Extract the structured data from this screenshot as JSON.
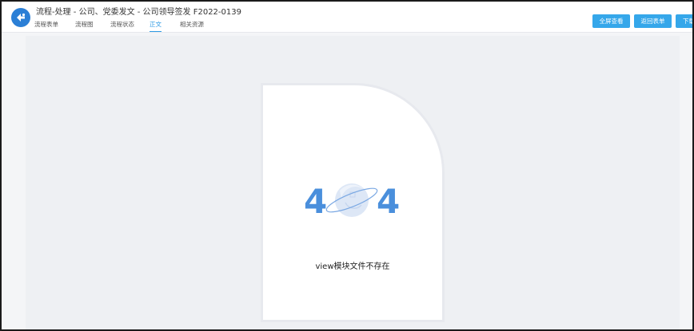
{
  "header": {
    "title": "流程-处理 - 公司、党委发文 - 公司领导签发 F2022-0139",
    "tabs": [
      {
        "label": "流程表单",
        "active": false
      },
      {
        "label": "流程图",
        "active": false
      },
      {
        "label": "流程状态",
        "active": false
      },
      {
        "label": "正文",
        "active": true
      },
      {
        "label": "相关资源",
        "active": false
      }
    ],
    "buttons": {
      "fullscreen": "全屏查看",
      "back_form": "返回表单",
      "download": "下载"
    }
  },
  "error": {
    "code_left": "4",
    "code_right": "4",
    "message": "view模块文件不存在"
  },
  "colors": {
    "accent": "#2f9be4",
    "button": "#35a7ea",
    "digit": "#4a8fdc"
  }
}
